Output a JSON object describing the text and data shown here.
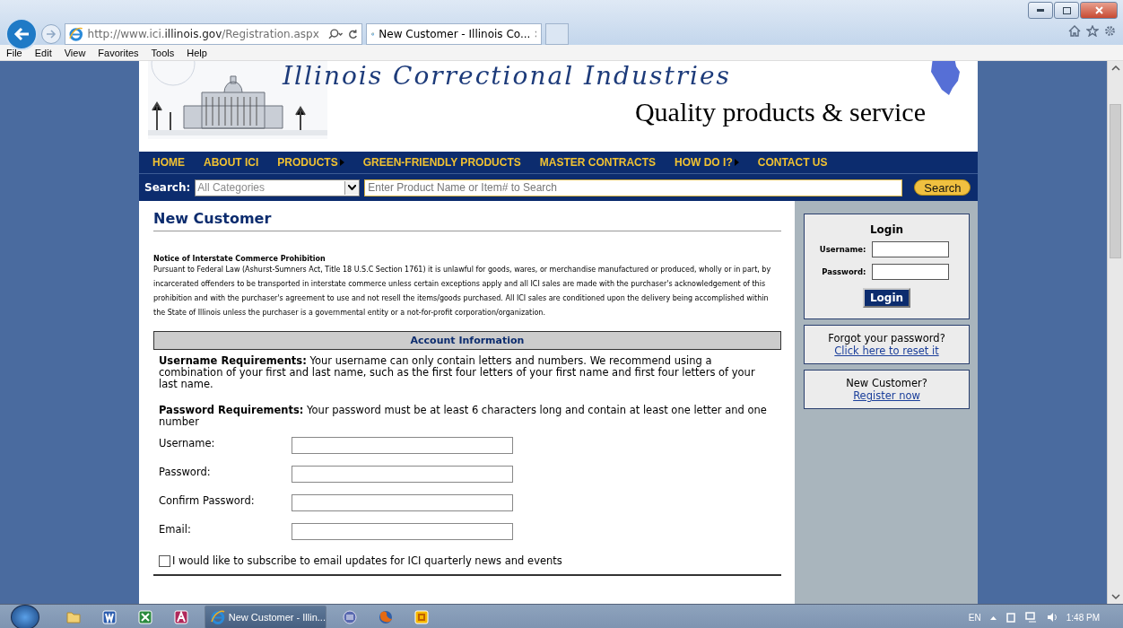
{
  "browser": {
    "url_prefix": "http://www.ici.",
    "url_domain": "illinois.gov",
    "url_path": "/Registration.aspx",
    "tabs": [
      {
        "title": "New Customer - Illinois Co...",
        "selected": true
      }
    ],
    "menu": [
      "File",
      "Edit",
      "View",
      "Favorites",
      "Tools",
      "Help"
    ]
  },
  "banner": {
    "title": "Illinois Correctional Industries",
    "tagline": "Quality products & service"
  },
  "nav": [
    {
      "label": "HOME",
      "submenu": false
    },
    {
      "label": "ABOUT ICI",
      "submenu": false
    },
    {
      "label": "PRODUCTS",
      "submenu": true
    },
    {
      "label": "GREEN-FRIENDLY PRODUCTS",
      "submenu": false
    },
    {
      "label": "MASTER CONTRACTS",
      "submenu": false
    },
    {
      "label": "HOW DO I?",
      "submenu": true
    },
    {
      "label": "CONTACT US",
      "submenu": false
    }
  ],
  "search": {
    "label": "Search:",
    "category": "All Categories",
    "placeholder": "Enter Product Name or Item# to Search",
    "button": "Search"
  },
  "page": {
    "heading": "New Customer",
    "notice_title": "Notice of Interstate Commerce Prohibition",
    "notice_text": "Pursuant to Federal Law (Ashurst-Sumners Act, Title 18 U.S.C Section 1761) it is unlawful for goods, wares, or merchandise manufactured or produced, wholly or in part, by incarcerated offenders to be transported in interstate commerce unless certain exceptions apply and all ICI sales are made with the purchaser's acknowledgement of this prohibition and with the purchaser's agreement to use and not resell the items/goods purchased. All ICI sales are conditioned upon the delivery being accomplished within the State of Illinois unless the purchaser is a governmental entity or a not-for-profit corporation/organization.",
    "section_title": "Account Information",
    "requirements": [
      "**Username Requirements:** Your username can only contain letters and numbers. We recommend using a combination of your first and last name, such as the first four letters of your first name and first four letters of your last name.",
      "**Password Requirements:** Your password must be at least 6 characters long and contain at least one letter and one number"
    ],
    "fields": [
      {
        "label": "Username:"
      },
      {
        "label": "Password:"
      },
      {
        "label": "Confirm Password:"
      },
      {
        "label": "Email:"
      }
    ],
    "subscribe": {
      "label": "I would like to subscribe to email updates for ICI quarterly news and events",
      "checked": false
    }
  },
  "sidebar": {
    "login": {
      "title": "Login",
      "fields": [
        {
          "label": "Username:"
        },
        {
          "label": "Password:"
        }
      ],
      "button": "Login"
    },
    "boxes": [
      {
        "text": "Forgot your password?",
        "link": "Click here to reset it"
      },
      {
        "text": "New Customer?",
        "link": "Register now"
      }
    ]
  },
  "taskbar": {
    "apps": [
      {
        "kind": "folder",
        "selected": false
      },
      {
        "kind": "word",
        "selected": false
      },
      {
        "kind": "excel",
        "selected": false
      },
      {
        "kind": "access",
        "selected": false
      },
      {
        "kind": "ie",
        "label": "New Customer - Illin...",
        "selected": true
      },
      {
        "kind": "disc",
        "selected": false
      },
      {
        "kind": "firefox",
        "selected": false
      },
      {
        "kind": "outlook",
        "selected": false
      }
    ],
    "language": "EN",
    "time": "1:48 PM"
  }
}
